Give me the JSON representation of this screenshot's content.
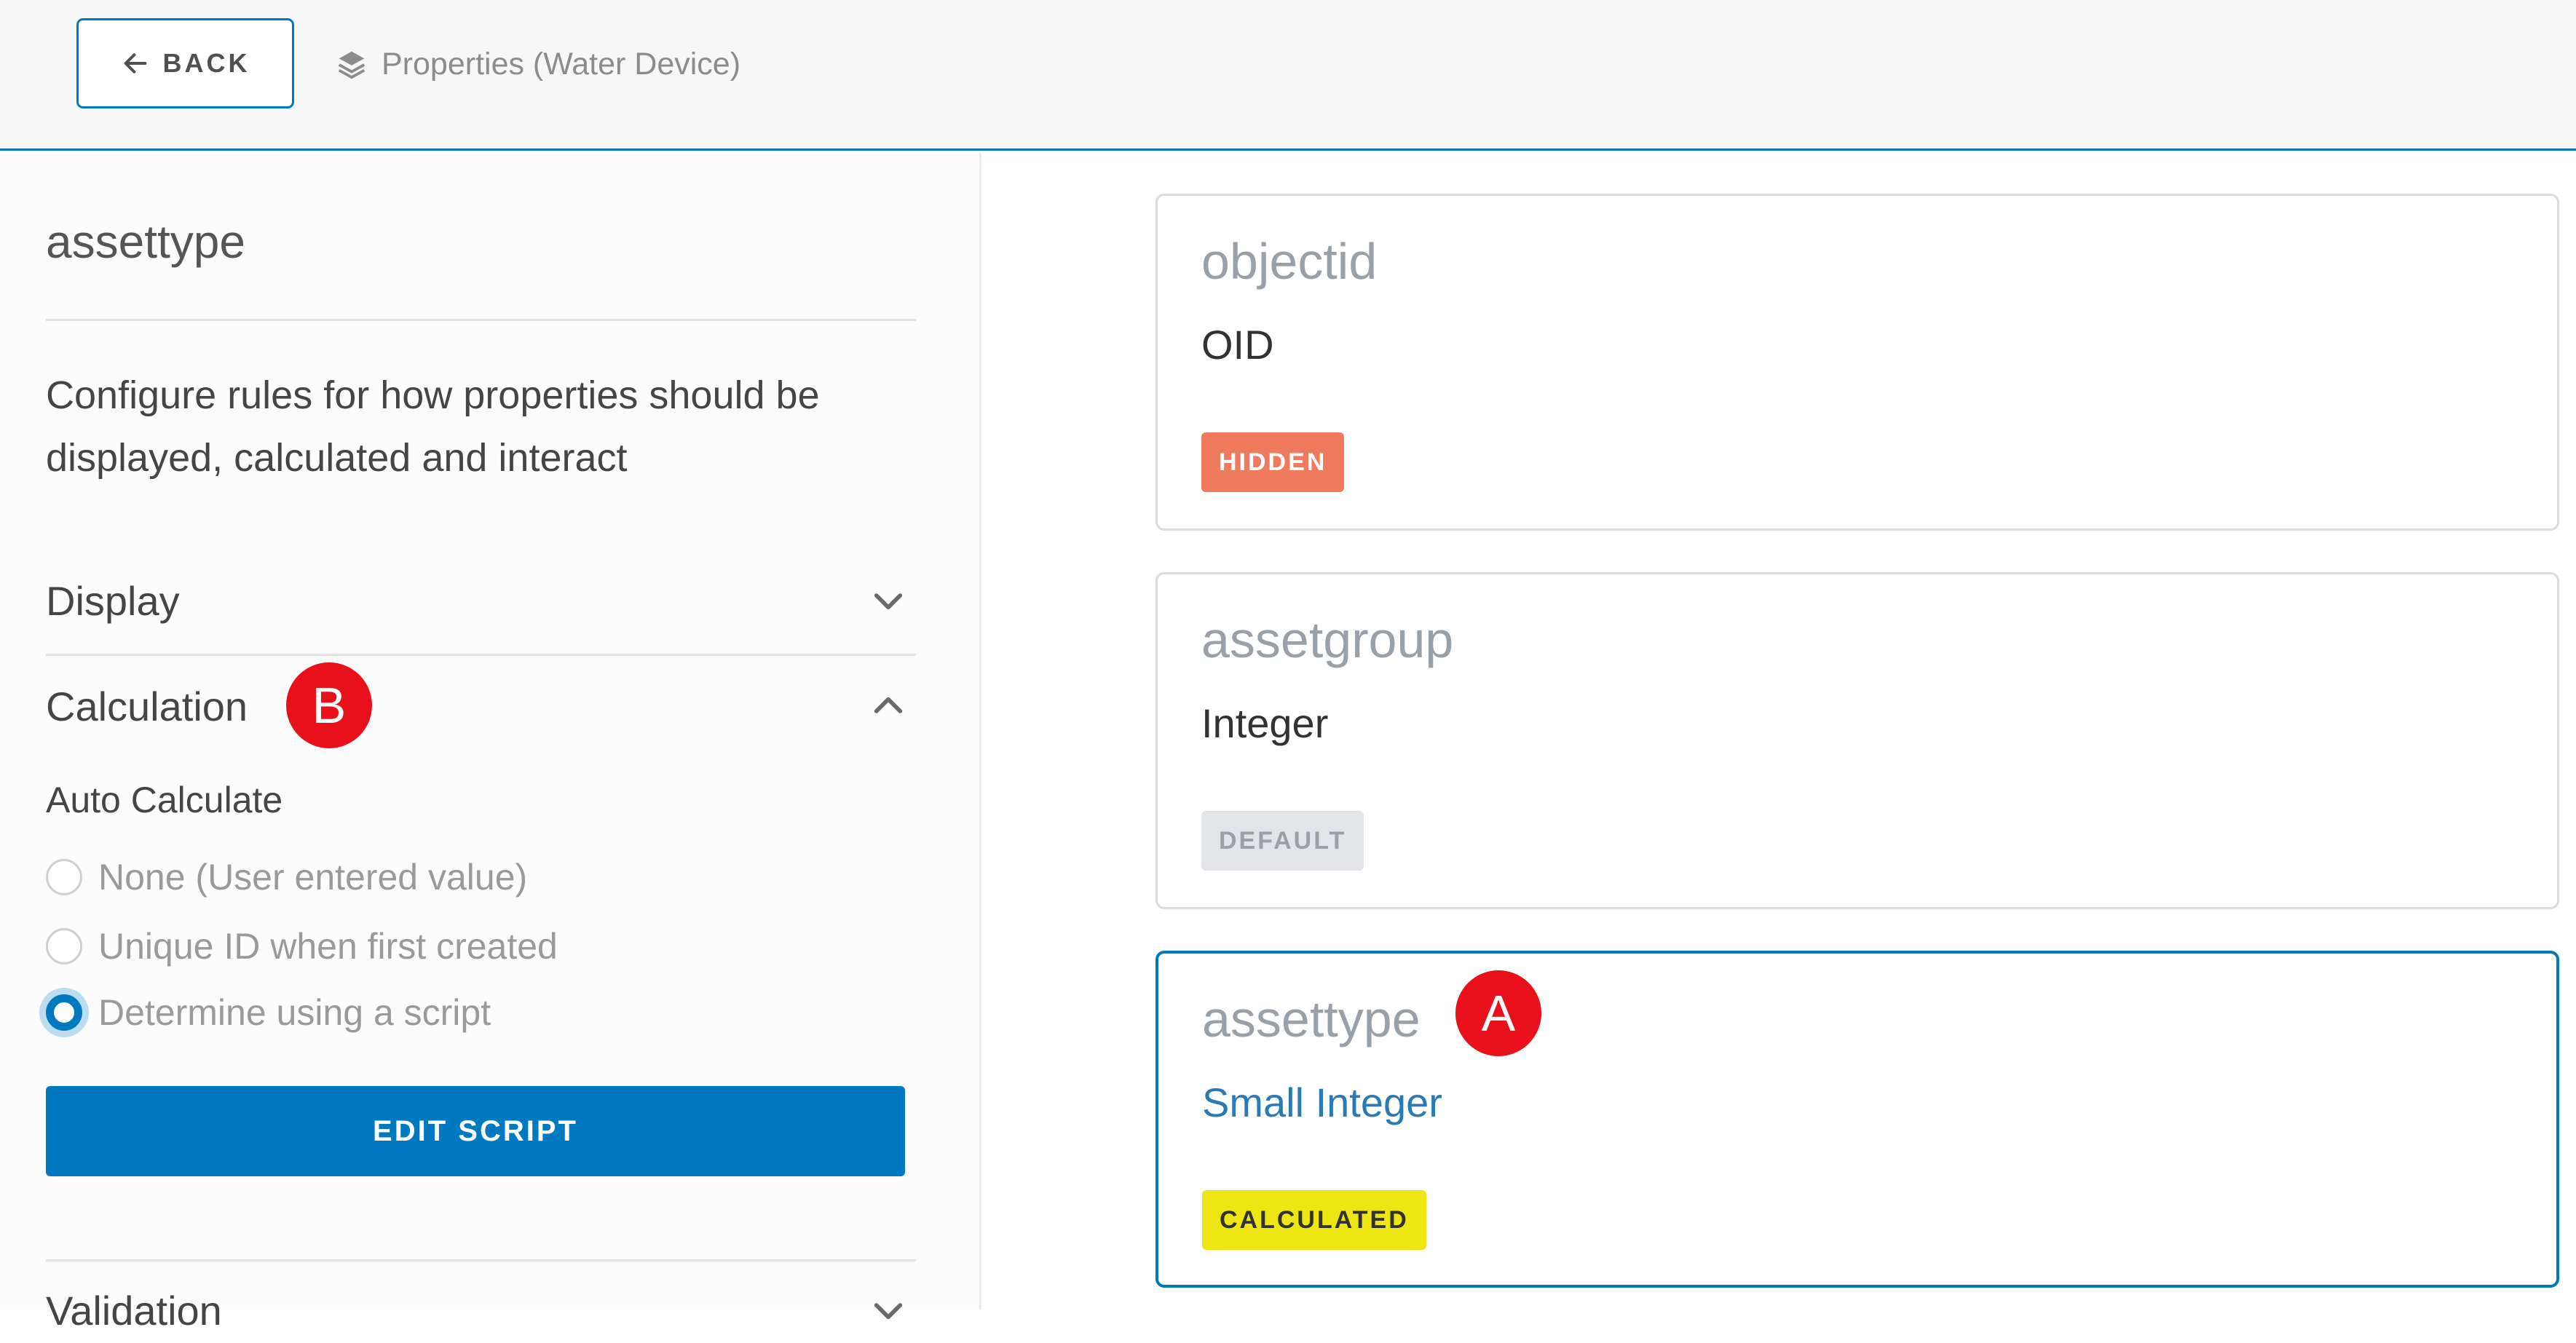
{
  "header": {
    "back_label": "BACK",
    "breadcrumb": "Properties (Water Device)"
  },
  "panel": {
    "title": "assettype",
    "description": "Configure rules for how properties should be displayed, calculated and interact",
    "sections": {
      "display": "Display",
      "calculation": "Calculation",
      "validation": "Validation"
    },
    "auto_calculate": {
      "label": "Auto Calculate",
      "options": [
        {
          "label": "None (User entered value)",
          "checked": false
        },
        {
          "label": "Unique ID when first created",
          "checked": false
        },
        {
          "label": "Determine using a script",
          "checked": true
        }
      ]
    },
    "edit_script_label": "EDIT SCRIPT"
  },
  "cards": [
    {
      "name": "objectid",
      "type": "OID",
      "tag": "HIDDEN",
      "tag_color": "#ef7a5e",
      "tag_text_color": "#ffffff",
      "selected": false
    },
    {
      "name": "assetgroup",
      "type": "Integer",
      "tag": "DEFAULT",
      "tag_color": "#e3e4e7",
      "tag_text_color": "#9aa0a8",
      "selected": false
    },
    {
      "name": "assettype",
      "type": "Small Integer",
      "tag": "CALCULATED",
      "tag_color": "#eee612",
      "tag_text_color": "#323232",
      "selected": true
    }
  ],
  "callouts": {
    "a": "A",
    "b": "B"
  },
  "colors": {
    "accent": "#0079c1",
    "callout": "#e8101a"
  }
}
